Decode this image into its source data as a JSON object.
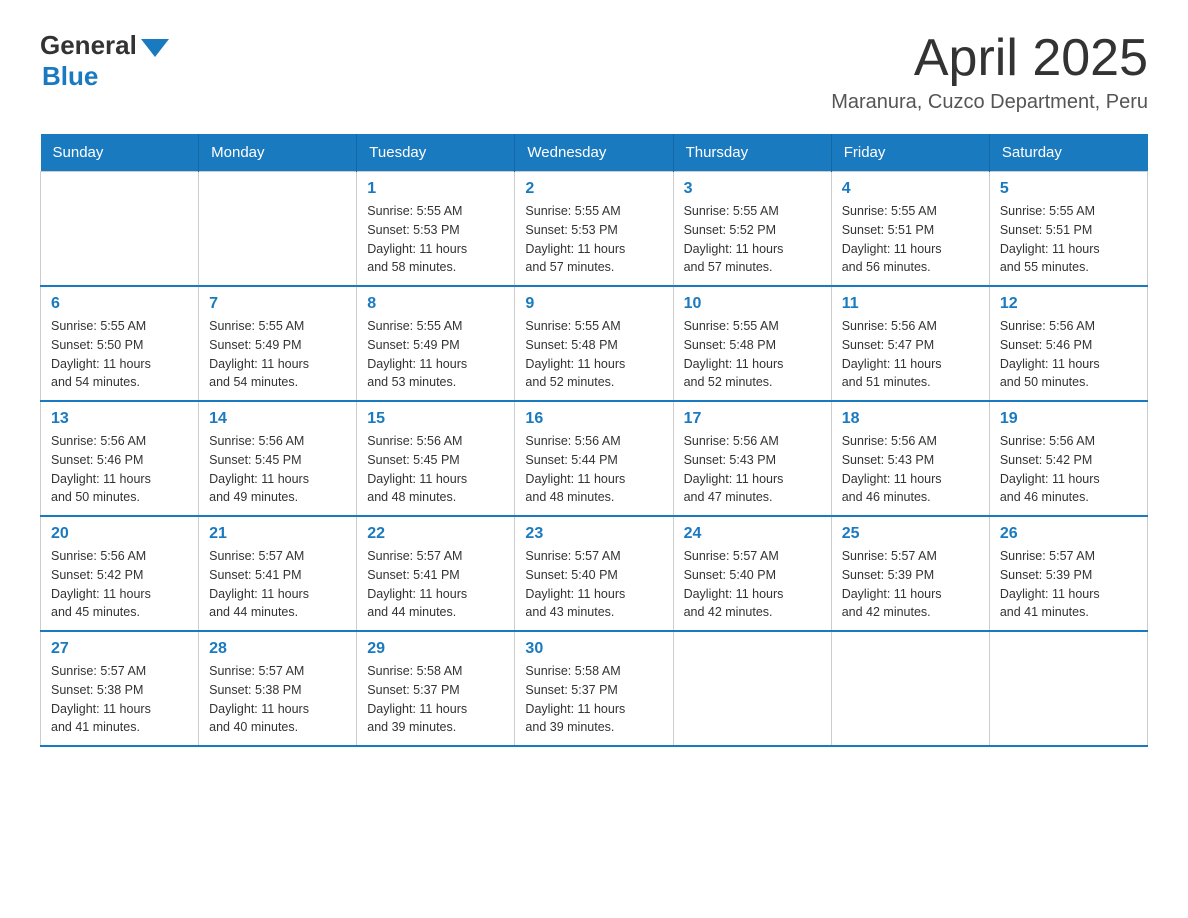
{
  "logo": {
    "general": "General",
    "blue": "Blue"
  },
  "header": {
    "month_title": "April 2025",
    "location": "Maranura, Cuzco Department, Peru"
  },
  "days_of_week": [
    "Sunday",
    "Monday",
    "Tuesday",
    "Wednesday",
    "Thursday",
    "Friday",
    "Saturday"
  ],
  "weeks": [
    [
      {
        "day": "",
        "info": ""
      },
      {
        "day": "",
        "info": ""
      },
      {
        "day": "1",
        "info": "Sunrise: 5:55 AM\nSunset: 5:53 PM\nDaylight: 11 hours\nand 58 minutes."
      },
      {
        "day": "2",
        "info": "Sunrise: 5:55 AM\nSunset: 5:53 PM\nDaylight: 11 hours\nand 57 minutes."
      },
      {
        "day": "3",
        "info": "Sunrise: 5:55 AM\nSunset: 5:52 PM\nDaylight: 11 hours\nand 57 minutes."
      },
      {
        "day": "4",
        "info": "Sunrise: 5:55 AM\nSunset: 5:51 PM\nDaylight: 11 hours\nand 56 minutes."
      },
      {
        "day": "5",
        "info": "Sunrise: 5:55 AM\nSunset: 5:51 PM\nDaylight: 11 hours\nand 55 minutes."
      }
    ],
    [
      {
        "day": "6",
        "info": "Sunrise: 5:55 AM\nSunset: 5:50 PM\nDaylight: 11 hours\nand 54 minutes."
      },
      {
        "day": "7",
        "info": "Sunrise: 5:55 AM\nSunset: 5:49 PM\nDaylight: 11 hours\nand 54 minutes."
      },
      {
        "day": "8",
        "info": "Sunrise: 5:55 AM\nSunset: 5:49 PM\nDaylight: 11 hours\nand 53 minutes."
      },
      {
        "day": "9",
        "info": "Sunrise: 5:55 AM\nSunset: 5:48 PM\nDaylight: 11 hours\nand 52 minutes."
      },
      {
        "day": "10",
        "info": "Sunrise: 5:55 AM\nSunset: 5:48 PM\nDaylight: 11 hours\nand 52 minutes."
      },
      {
        "day": "11",
        "info": "Sunrise: 5:56 AM\nSunset: 5:47 PM\nDaylight: 11 hours\nand 51 minutes."
      },
      {
        "day": "12",
        "info": "Sunrise: 5:56 AM\nSunset: 5:46 PM\nDaylight: 11 hours\nand 50 minutes."
      }
    ],
    [
      {
        "day": "13",
        "info": "Sunrise: 5:56 AM\nSunset: 5:46 PM\nDaylight: 11 hours\nand 50 minutes."
      },
      {
        "day": "14",
        "info": "Sunrise: 5:56 AM\nSunset: 5:45 PM\nDaylight: 11 hours\nand 49 minutes."
      },
      {
        "day": "15",
        "info": "Sunrise: 5:56 AM\nSunset: 5:45 PM\nDaylight: 11 hours\nand 48 minutes."
      },
      {
        "day": "16",
        "info": "Sunrise: 5:56 AM\nSunset: 5:44 PM\nDaylight: 11 hours\nand 48 minutes."
      },
      {
        "day": "17",
        "info": "Sunrise: 5:56 AM\nSunset: 5:43 PM\nDaylight: 11 hours\nand 47 minutes."
      },
      {
        "day": "18",
        "info": "Sunrise: 5:56 AM\nSunset: 5:43 PM\nDaylight: 11 hours\nand 46 minutes."
      },
      {
        "day": "19",
        "info": "Sunrise: 5:56 AM\nSunset: 5:42 PM\nDaylight: 11 hours\nand 46 minutes."
      }
    ],
    [
      {
        "day": "20",
        "info": "Sunrise: 5:56 AM\nSunset: 5:42 PM\nDaylight: 11 hours\nand 45 minutes."
      },
      {
        "day": "21",
        "info": "Sunrise: 5:57 AM\nSunset: 5:41 PM\nDaylight: 11 hours\nand 44 minutes."
      },
      {
        "day": "22",
        "info": "Sunrise: 5:57 AM\nSunset: 5:41 PM\nDaylight: 11 hours\nand 44 minutes."
      },
      {
        "day": "23",
        "info": "Sunrise: 5:57 AM\nSunset: 5:40 PM\nDaylight: 11 hours\nand 43 minutes."
      },
      {
        "day": "24",
        "info": "Sunrise: 5:57 AM\nSunset: 5:40 PM\nDaylight: 11 hours\nand 42 minutes."
      },
      {
        "day": "25",
        "info": "Sunrise: 5:57 AM\nSunset: 5:39 PM\nDaylight: 11 hours\nand 42 minutes."
      },
      {
        "day": "26",
        "info": "Sunrise: 5:57 AM\nSunset: 5:39 PM\nDaylight: 11 hours\nand 41 minutes."
      }
    ],
    [
      {
        "day": "27",
        "info": "Sunrise: 5:57 AM\nSunset: 5:38 PM\nDaylight: 11 hours\nand 41 minutes."
      },
      {
        "day": "28",
        "info": "Sunrise: 5:57 AM\nSunset: 5:38 PM\nDaylight: 11 hours\nand 40 minutes."
      },
      {
        "day": "29",
        "info": "Sunrise: 5:58 AM\nSunset: 5:37 PM\nDaylight: 11 hours\nand 39 minutes."
      },
      {
        "day": "30",
        "info": "Sunrise: 5:58 AM\nSunset: 5:37 PM\nDaylight: 11 hours\nand 39 minutes."
      },
      {
        "day": "",
        "info": ""
      },
      {
        "day": "",
        "info": ""
      },
      {
        "day": "",
        "info": ""
      }
    ]
  ]
}
